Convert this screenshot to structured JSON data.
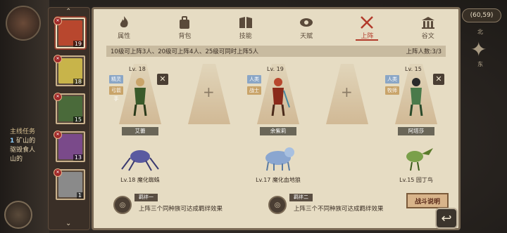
{
  "hud": {
    "coordinates": "(60,59)",
    "compass_north": "北",
    "compass_east": "东",
    "quest_title": "主线任务",
    "quest_number": "1",
    "quest_text_line1": "矿山的",
    "quest_text_line2": "驱毁食人",
    "quest_text_line3": "山的"
  },
  "roster": {
    "up_arrow": "⌃",
    "down_arrow": "⌄",
    "heroes": [
      {
        "level": "19",
        "badge": "✕",
        "color": "#b8472e",
        "active": true
      },
      {
        "level": "18",
        "badge": "✕",
        "color": "#c8b44a",
        "active": false
      },
      {
        "level": "15",
        "badge": "✕",
        "color": "#4a6a3a",
        "active": false
      },
      {
        "level": "13",
        "badge": "✕",
        "color": "#7a4a8a",
        "active": false
      },
      {
        "level": "1",
        "badge": "✕",
        "color": "#8a8a8a",
        "active": false
      }
    ]
  },
  "tabs": [
    {
      "label": "属性",
      "icon": "flame-icon",
      "active": false
    },
    {
      "label": "背包",
      "icon": "bag-icon",
      "active": false
    },
    {
      "label": "技能",
      "icon": "book-icon",
      "active": false
    },
    {
      "label": "天赋",
      "icon": "eye-icon",
      "active": false
    },
    {
      "label": "上阵",
      "icon": "crossed-swords-icon",
      "active": true
    },
    {
      "label": "谷文",
      "icon": "temple-icon",
      "active": false
    }
  ],
  "info": {
    "rule": "10级可上阵3人、20级可上阵4人、25级可同时上阵5人",
    "count": "上阵人数:3/3"
  },
  "slots": [
    {
      "filled": true,
      "level": "Lv. 18",
      "race": "精灵",
      "cls": "弓箭手",
      "name": "艾蕾",
      "pet": "Lv.18 魔化蜘蛛",
      "color": "#3a5a2a",
      "pet_color": "#5a5aa0"
    },
    {
      "filled": false
    },
    {
      "filled": true,
      "level": "Lv. 19",
      "race": "人类",
      "cls": "战士",
      "name": "余紫莉",
      "pet": "Lv.17 魔化血地狼",
      "color": "#8a2a1a",
      "pet_color": "#8aa6d0"
    },
    {
      "filled": false
    },
    {
      "filled": true,
      "level": "Lv. 15",
      "race": "人类",
      "cls": "牧师",
      "name": "阿塔莎",
      "pet": "Lv.15 园丁鸟",
      "color": "#4a7a4a",
      "pet_color": "#7aa04a"
    }
  ],
  "bonds": [
    {
      "title": "羁绊一",
      "desc": "上阵三个同种族可达成羁绊效果"
    },
    {
      "title": "羁绊二",
      "desc": "上阵三个不同种族可达成羁绊效果"
    }
  ],
  "buttons": {
    "battle_info": "战斗说明",
    "close": "✕",
    "plus": "+"
  }
}
